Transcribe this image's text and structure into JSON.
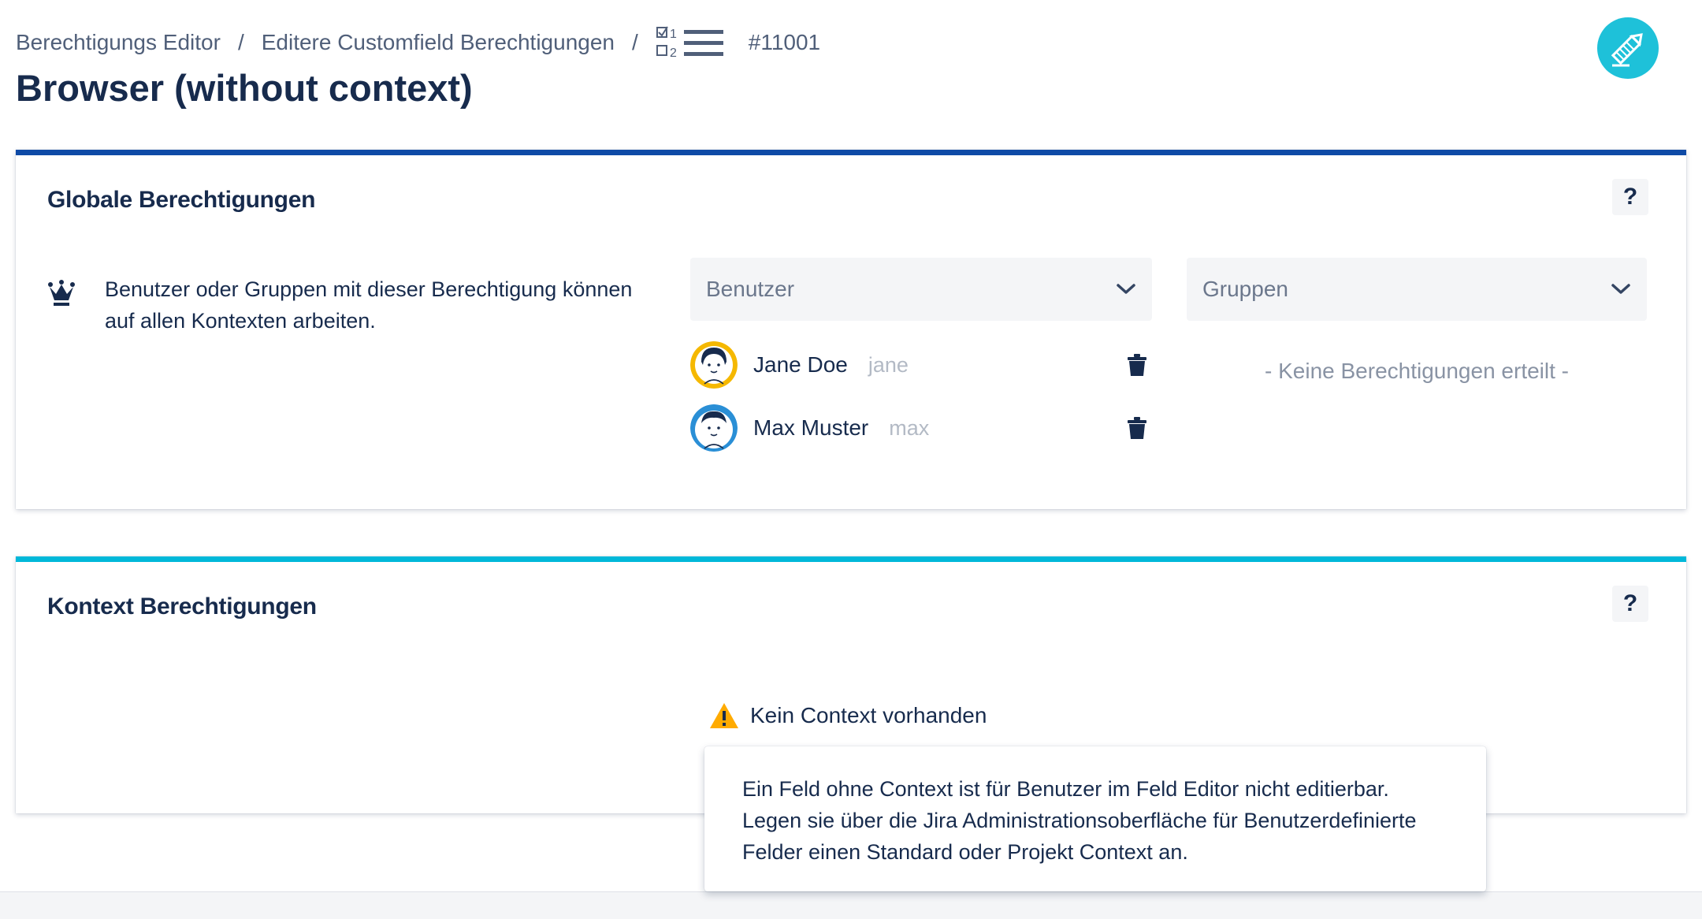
{
  "breadcrumb": {
    "items": [
      "Berechtigungs Editor",
      "Editere Customfield Berechtigungen"
    ],
    "separator": "/",
    "issue_number": "#11001",
    "list_icon_numbers": [
      "1",
      "2"
    ]
  },
  "page": {
    "title": "Browser (without context)"
  },
  "global_panel": {
    "title": "Globale Berechtigungen",
    "help_label": "?",
    "description": "Benutzer oder Gruppen mit dieser Berechtigung können auf allen Kontexten arbeiten.",
    "users_select_placeholder": "Benutzer",
    "groups_select_placeholder": "Gruppen",
    "users": [
      {
        "name": "Jane Doe",
        "login": "jane",
        "avatar_color": "#f5b800"
      },
      {
        "name": "Max Muster",
        "login": "max",
        "avatar_color": "#2a8fd6"
      }
    ],
    "groups_empty": "- Keine Berechtigungen erteilt -"
  },
  "context_panel": {
    "title": "Kontext Berechtigungen",
    "help_label": "?",
    "warning": "Kein Context vorhanden",
    "tooltip": "Ein Feld ohne Context ist für Benutzer im Feld Editor nicht editierbar. Legen sie über die Jira Administrationsoberfläche für Benutzerdefinierte Felder einen Standard oder Projekt Context an."
  },
  "colors": {
    "global_accent": "#0e4aa6",
    "context_accent": "#00b8d9",
    "logo": "#1ec1d9",
    "warning": "#ffab00"
  }
}
